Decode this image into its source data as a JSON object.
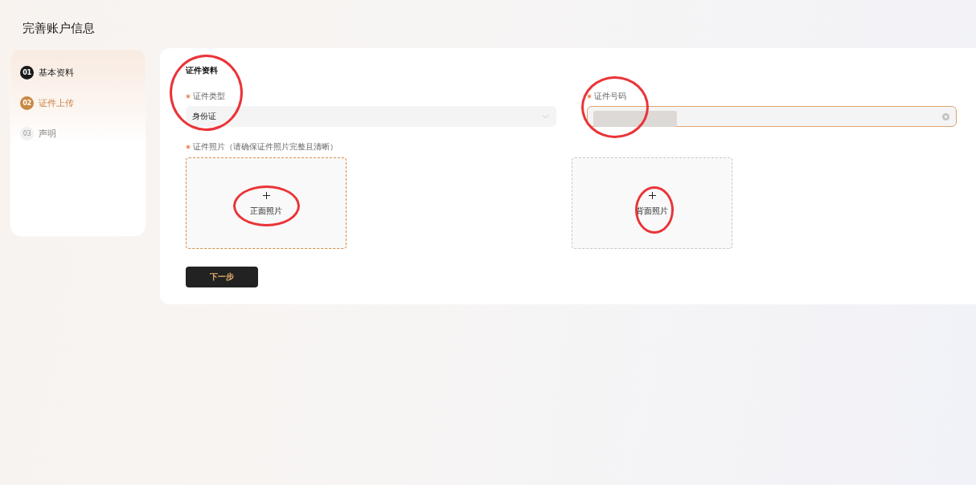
{
  "page": {
    "title": "完善账户信息"
  },
  "steps": [
    {
      "number": "01",
      "label": "基本资料",
      "completed": true,
      "selected": false
    },
    {
      "number": "02",
      "label": "证件上传",
      "completed": false,
      "selected": true
    },
    {
      "number": "03",
      "label": "声明",
      "completed": false,
      "selected": false
    }
  ],
  "form": {
    "section_title": "证件资料",
    "fields": [
      {
        "kind": "select",
        "label": "证件类型",
        "required": true,
        "value": "身份证",
        "focused": false,
        "circled": true
      },
      {
        "kind": "text",
        "label": "证件号码",
        "required": true,
        "value_masked": true,
        "clearable": true,
        "focused": true,
        "circled": true
      }
    ],
    "photos": {
      "label": "证件照片（请确保证件照片完整且清晰）",
      "required": true,
      "tiles": [
        {
          "label": "正面照片",
          "focused": true,
          "circled": true
        },
        {
          "label": "背面照片",
          "focused": false,
          "circled": true
        }
      ]
    },
    "next_button": "下一步"
  }
}
